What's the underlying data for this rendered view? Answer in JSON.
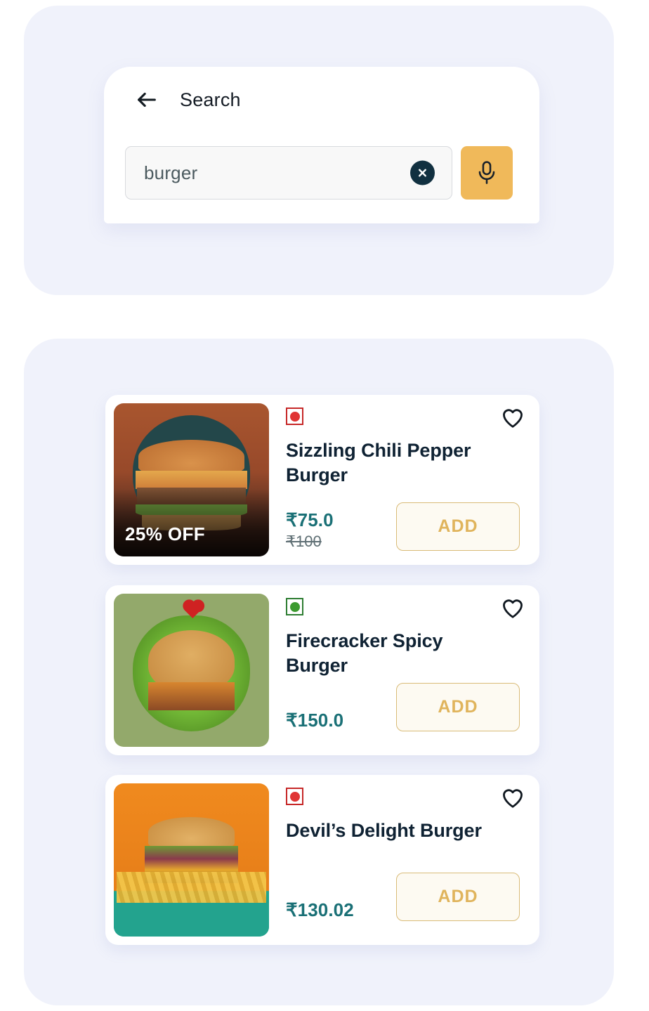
{
  "search": {
    "title": "Search",
    "query_value": "burger",
    "placeholder": "Search",
    "back_icon": "back-arrow-icon",
    "clear_icon": "clear-circle-icon",
    "mic_icon": "microphone-icon",
    "mic_color": "#f0b95a",
    "clear_color": "#113040"
  },
  "results": [
    {
      "name": "Sizzling Chili Pepper Burger",
      "diet": "non-veg",
      "price": "₹75.0",
      "original_price": "₹100",
      "discount_badge": "25% OFF",
      "add_label": "ADD",
      "favorite_icon": "heart-outline-icon",
      "diet_icon": "non-veg-indicator-icon"
    },
    {
      "name": "Firecracker Spicy Burger",
      "diet": "veg",
      "price": "₹150.0",
      "original_price": "",
      "discount_badge": "",
      "add_label": "ADD",
      "favorite_icon": "heart-outline-icon",
      "diet_icon": "veg-indicator-icon"
    },
    {
      "name": "Devil’s Delight Burger",
      "diet": "non-veg",
      "price": "₹130.02",
      "original_price": "",
      "discount_badge": "",
      "add_label": "ADD",
      "favorite_icon": "heart-outline-icon",
      "diet_icon": "non-veg-indicator-icon"
    }
  ],
  "colors": {
    "panel_bg": "#f0f2fb",
    "price": "#1a7076",
    "add_text": "#e0b45c",
    "add_border": "#d9bb78",
    "veg": "#3c9a2f",
    "non_veg": "#e03434",
    "title": "#0f2233"
  }
}
